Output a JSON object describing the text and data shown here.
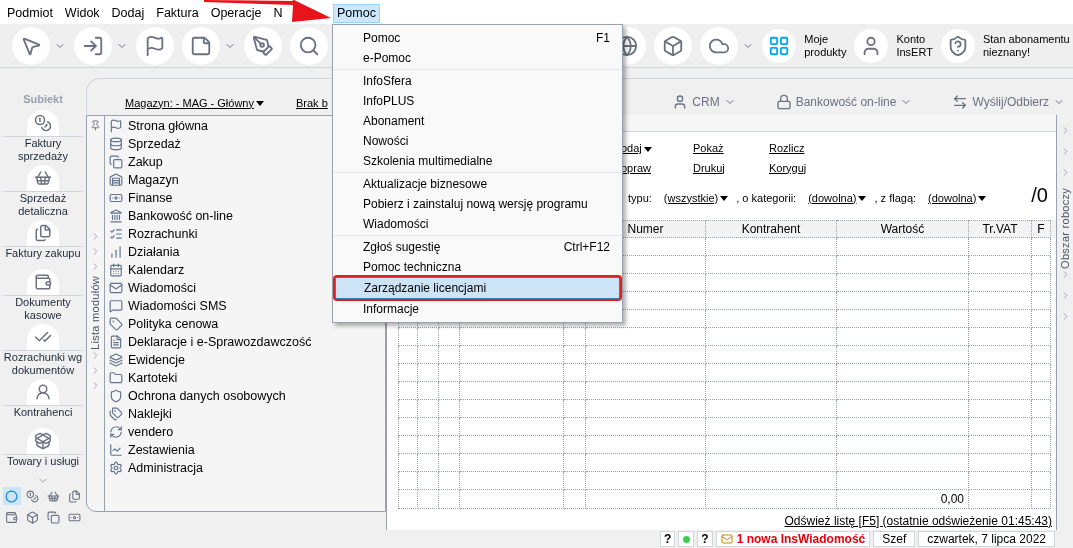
{
  "menu_bar": [
    {
      "label": "Podmiot",
      "selected": false
    },
    {
      "label": "Widok",
      "selected": false
    },
    {
      "label": "Dodaj",
      "selected": false
    },
    {
      "label": "Faktura",
      "selected": false
    },
    {
      "label": "Operacje",
      "selected": false
    },
    {
      "label": "N",
      "selected": false
    },
    {
      "label": "Pomoc",
      "selected": true
    }
  ],
  "toolbar": {
    "left_buttons": [
      {
        "has_menu": true
      },
      {
        "has_menu": true
      },
      {
        "has_menu": false
      },
      {
        "has_menu": true
      },
      {
        "has_menu": false
      },
      {
        "has_menu": false
      }
    ],
    "right_buttons": [
      {
        "has_menu": false
      },
      {
        "has_menu": false
      },
      {
        "has_menu": true
      }
    ],
    "shortcuts": [
      {
        "label": "Moje produkty"
      },
      {
        "label": "Konto InsERT"
      },
      {
        "label": "Stan abonamentu nieznany!"
      }
    ]
  },
  "nav": {
    "logo": "Subiekt",
    "items": [
      {
        "label": "Faktury sprzedaży"
      },
      {
        "label": "Sprzedaż detaliczna"
      },
      {
        "label": "Faktury zakupu"
      },
      {
        "label": "Dokumenty kasowe"
      },
      {
        "label": "Rozrachunki wg dokumentów"
      },
      {
        "label": "Kontrahenci"
      },
      {
        "label": "Towary i usługi"
      }
    ],
    "quick_icons": [
      {
        "selected": true
      },
      {
        "selected": false
      },
      {
        "selected": false
      },
      {
        "selected": false
      },
      {
        "selected": false
      },
      {
        "selected": false
      },
      {
        "selected": false
      },
      {
        "selected": false
      }
    ]
  },
  "top_bar": {
    "warehouse": "Magazyn: - MAG - Główny",
    "cut_link": "Brak b",
    "actions": [
      "CRM",
      "Bankowość on-line",
      "Wyślij/Odbierz"
    ]
  },
  "modules": {
    "title": "Lista modułów",
    "items": [
      "Strona główna",
      "Sprzedaż",
      "Zakup",
      "Magazyn",
      "Finanse",
      "Bankowość on-line",
      "Rozrachunki",
      "Działania",
      "Kalendarz",
      "Wiadomości",
      "Wiadomości SMS",
      "Polityka cenowa",
      "Deklaracje i e-Sprawozdawczość",
      "Ewidencje",
      "Kartoteki",
      "Ochrona danych osobowych",
      "Naklejki",
      "vendero",
      "Zestawienia",
      "Administracja"
    ]
  },
  "documents": {
    "links": [
      {
        "label": "odaj",
        "has_menu": true
      },
      {
        "label": "Pokaż",
        "has_menu": false
      },
      {
        "label": "Rozlicz",
        "has_menu": false
      },
      {
        "label": "opraw",
        "has_menu": false
      },
      {
        "label": "Drukuj",
        "has_menu": false
      },
      {
        "label": "Koryguj",
        "has_menu": false
      }
    ],
    "filters": [
      {
        "label": "typu:",
        "value": "(wszystkie)"
      },
      {
        "label": ", o kategorii:",
        "value": "(dowolna)"
      },
      {
        "label": ", z flagą:",
        "value": "(dowolna)"
      }
    ],
    "count": "/0",
    "columns": [
      "Numer",
      "Kontrahent",
      "Wartość",
      "Tr.VAT",
      "F"
    ],
    "total": "0,00",
    "refresh": "Odśwież listę [F5] (ostatnie odświeżenie 01:45:43)"
  },
  "workspace_tab": "Obszar roboczy",
  "status_bar": {
    "help_left": "?",
    "help_right": "?",
    "message": "1 nowa InsWiadomość",
    "user": "Szef",
    "date": "czwartek, 7 lipca 2022"
  },
  "help_menu": {
    "groups": [
      [
        {
          "label": "Pomoc",
          "shortcut": "F1",
          "selected": false
        },
        {
          "label": "e-Pomoc",
          "selected": false
        }
      ],
      [
        {
          "label": "InfoSfera",
          "selected": false
        },
        {
          "label": "InfoPLUS",
          "selected": false
        },
        {
          "label": "Abonament",
          "selected": false
        },
        {
          "label": "Nowości",
          "selected": false
        },
        {
          "label": "Szkolenia multimedialne",
          "selected": false
        }
      ],
      [
        {
          "label": "Aktualizacje biznesowe",
          "selected": false
        },
        {
          "label": "Pobierz i zainstaluj nową wersję programu",
          "selected": false
        },
        {
          "label": "Wiadomości",
          "selected": false
        }
      ],
      [
        {
          "label": "Zgłoś sugestię",
          "shortcut": "Ctrl+F12",
          "selected": false
        },
        {
          "label": "Pomoc techniczna",
          "selected": false
        },
        {
          "label": "Zarządzanie licencjami",
          "selected": true
        },
        {
          "label": "Informacje",
          "selected": false
        }
      ]
    ]
  }
}
